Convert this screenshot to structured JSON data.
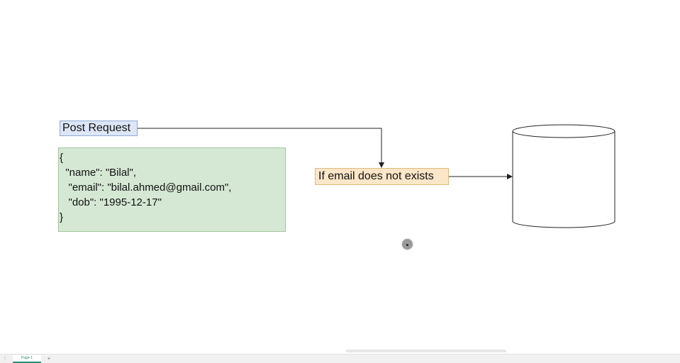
{
  "diagram": {
    "request_label": "Post Request",
    "payload_lines": [
      "{",
      "  \"name\": \"Bilal\",",
      "   \"email\": \"bilal.ahmed@gmail.com\",",
      "   \"dob\": \"1995-12-17\"",
      "}"
    ],
    "condition_label": "If email does not exists",
    "database_label": ""
  },
  "footer": {
    "page_tab_label": "Page-1",
    "add_page_symbol": "+",
    "menu_symbol": "⋮"
  },
  "colors": {
    "request_fill": "#dde6f6",
    "payload_fill": "#d5e8d4",
    "condition_fill": "#fbe6c8",
    "tab_accent": "#2a8c7a"
  }
}
